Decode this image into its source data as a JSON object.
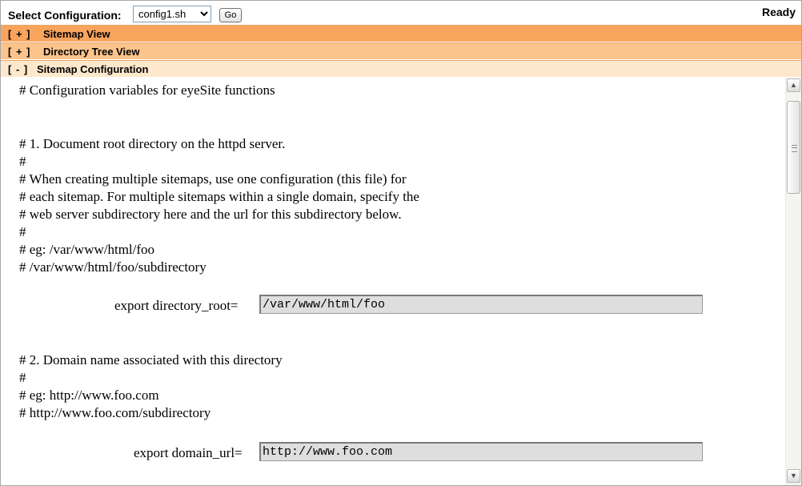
{
  "toolbar": {
    "label": "Select Configuration:",
    "config_value": "config1.sh",
    "go_label": "Go",
    "status": "Ready"
  },
  "panels": [
    {
      "toggle": "[ + ]",
      "title": "Sitemap View"
    },
    {
      "toggle": "[ + ]",
      "title": "Directory Tree View"
    },
    {
      "toggle": "[ - ]",
      "title": "Sitemap Configuration"
    }
  ],
  "config": {
    "lines": [
      "# Configuration variables for eyeSite functions",
      "# 1. Document root directory on the httpd server.",
      "#",
      "# When creating multiple sitemaps, use one configuration (this file) for",
      "# each sitemap. For multiple sitemaps within a single domain, specify the",
      "# web server subdirectory here and the url for this subdirectory below.",
      "#",
      "# eg: /var/www/html/foo",
      "# /var/www/html/foo/subdirectory",
      "# 2. Domain name associated with this directory",
      "#",
      "# eg: http://www.foo.com",
      "# http://www.foo.com/subdirectory"
    ],
    "directory_root_label": "export directory_root=",
    "directory_root_value": "/var/www/html/foo",
    "domain_url_label": "export domain_url=",
    "domain_url_value": "http://www.foo.com"
  },
  "scrollbar": {
    "up_icon": "triangle-up",
    "down_icon": "triangle-down"
  }
}
